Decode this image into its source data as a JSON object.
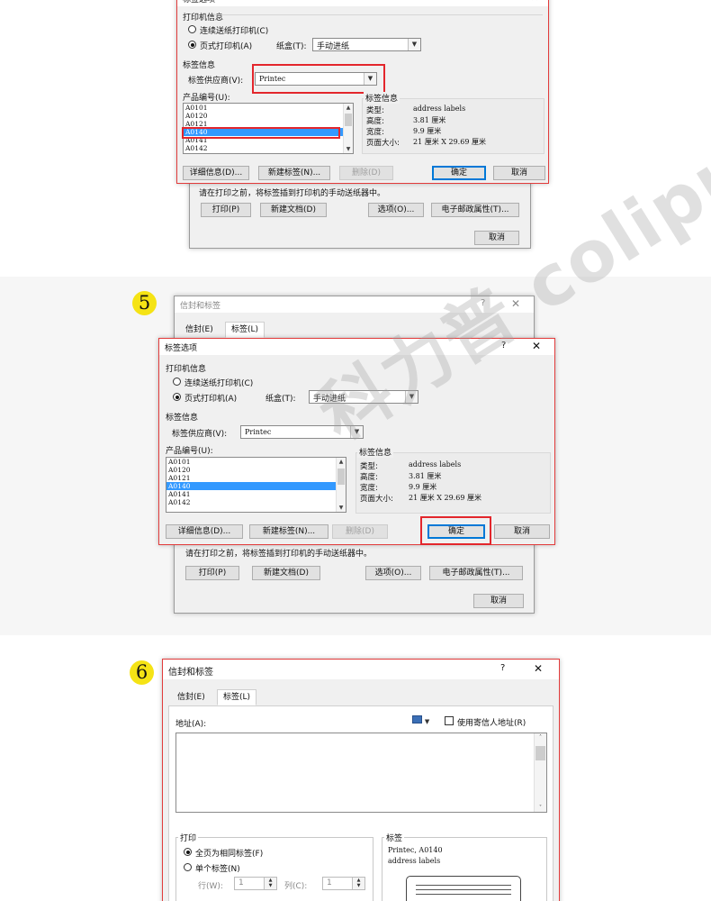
{
  "steps": {
    "five": "5",
    "six": "6"
  },
  "label_dialog": {
    "title": "标签选项",
    "printer_group": "打印机信息",
    "continuous": "连续送纸打印机(C)",
    "page_printer": "页式打印机(A)",
    "tray_label": "纸盒(T):",
    "tray_value": "手动进纸",
    "label_group": "标签信息",
    "vendor_label": "标签供应商(V):",
    "vendor_value": "Printec",
    "product_label": "产品编号(U):",
    "products": [
      "A0101",
      "A0120",
      "A0121",
      "A0140",
      "A0141",
      "A0142"
    ],
    "selected_product": "A0140",
    "info_title": "标签信息",
    "info": [
      {
        "key": "类型:",
        "value": "address labels"
      },
      {
        "key": "高度:",
        "value": "3.81 厘米"
      },
      {
        "key": "宽度:",
        "value": "9.9 厘米"
      },
      {
        "key": "页面大小:",
        "value": "21 厘米 X 29.69 厘米"
      }
    ],
    "details_btn": "详细信息(D)...",
    "new_label_btn": "新建标签(N)...",
    "delete_btn": "删除(D)",
    "ok_btn": "确定",
    "cancel_btn": "取消"
  },
  "envelope_dialog": {
    "title": "信封和标签",
    "tab_envelope": "信封(E)",
    "tab_label": "标签(L)",
    "hint": "请在打印之前，将标签插到打印机的手动送纸器中。",
    "print_btn": "打印(P)",
    "new_doc_btn": "新建文档(D)",
    "options_btn": "选项(O)...",
    "epostage_btn": "电子邮政属性(T)...",
    "cancel_btn": "取消",
    "address_label": "地址(A):",
    "use_return_address": "使用寄信人地址(R)",
    "print_group": "打印",
    "full_page": "全页为相同标签(F)",
    "single_label": "单个标签(N)",
    "row_label": "行(W):",
    "row_value": "1",
    "col_label": "列(C):",
    "col_value": "1",
    "label_group": "标签",
    "label_desc_1": "Printec, A0140",
    "label_desc_2": "address labels"
  },
  "window_controls": {
    "help": "?",
    "close": "✕"
  },
  "watermark": "科力普 colipu.com",
  "colors": {
    "highlight": "#e3262c",
    "badge": "#f5e315",
    "selection": "#3399ff",
    "default_button": "#0078d7"
  },
  "icons": [
    "radio",
    "dropdown-arrow",
    "scroll-up",
    "scroll-down",
    "address-book-icon",
    "checkbox",
    "spinner"
  ]
}
